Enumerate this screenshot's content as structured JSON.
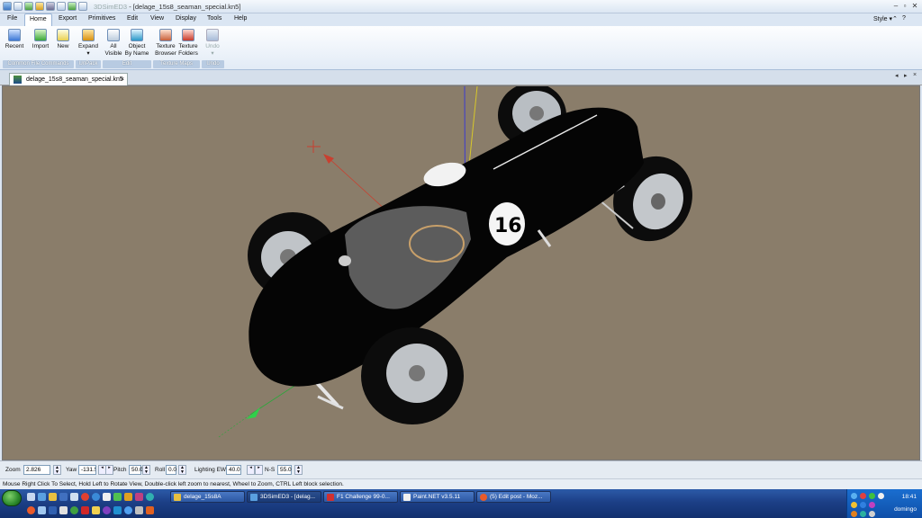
{
  "window": {
    "app_title": "3DSimED3",
    "doc_title": "- [delage_15s8_seaman_special.kn5]"
  },
  "menu": {
    "items": [
      "File",
      "Home",
      "Export",
      "Primitives",
      "Edit",
      "View",
      "Display",
      "Tools",
      "Help"
    ],
    "active": "Home",
    "style_label": "Style",
    "style_arrow": "▾"
  },
  "ribbon": {
    "buttons": {
      "recent": "Recent",
      "import": "Import",
      "new": "New",
      "expand": "Expand",
      "all_visible": "All Visible",
      "object_by_name": "Object By Name",
      "texture_browser": "Texture Browser",
      "texture_folders": "Texture Folders",
      "undo": "Undo"
    },
    "groups": {
      "common": "Common File Commands",
      "unpack": "UnPack",
      "edit": "Edit",
      "texture_maps": "Texture Maps",
      "undo": "Undo"
    }
  },
  "document_tab": {
    "label": "delage_15s8_seaman_special.kn5"
  },
  "car": {
    "number": "16"
  },
  "bottom_controls": {
    "zoom_label": "Zoom",
    "zoom_value": "2.826",
    "yaw_label": "Yaw",
    "yaw_value": "-131.5",
    "pitch_label": "Pitch",
    "pitch_value": "50.0",
    "roll_label": "Roll",
    "roll_value": "0.0",
    "lighting_label": "Lighting EW",
    "lighting_value": "40.0",
    "ns_label": "N-S",
    "ns_value": "55.0"
  },
  "status": {
    "text": "Mouse Right Click To Select, Hold Left to Rotate View, Double-click left  zoom to nearest, Wheel to Zoom, CTRL Left block selection."
  },
  "taskbar": {
    "tasks": [
      "delage_15s8A",
      "3DSimED3 - [delag...",
      "F1 Challenge 99-0...",
      "Paint.NET v3.5.11",
      "(5) Edit post - Moz..."
    ],
    "clock": "18:41",
    "user": "domingo"
  },
  "colors": {
    "viewport_bg": "#8a7d6a",
    "car_body": "#050505",
    "taskbar": "#1c3f86"
  }
}
